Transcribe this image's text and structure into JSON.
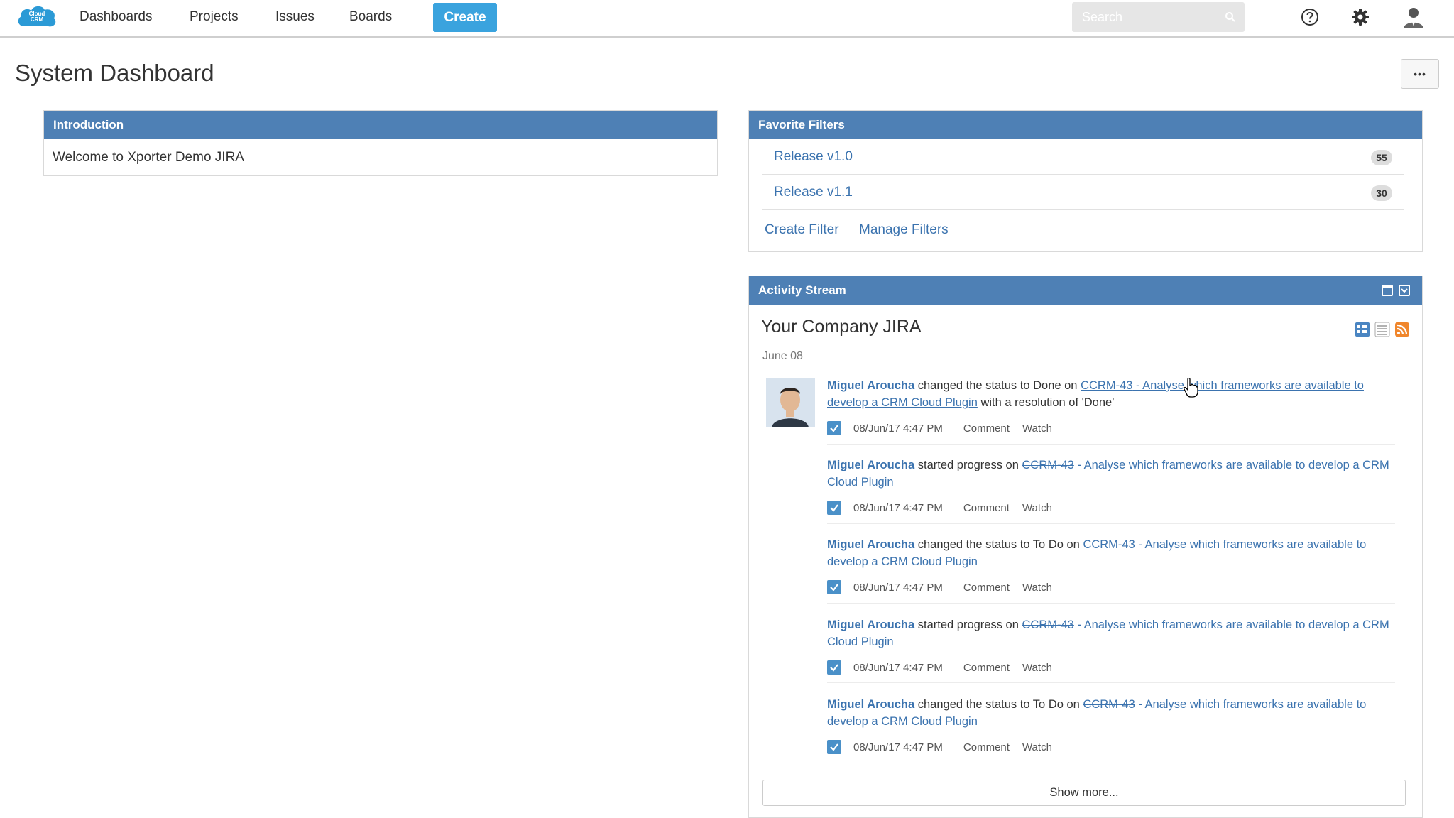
{
  "nav": {
    "logo_text": "Cloud CRM",
    "items": [
      "Dashboards",
      "Projects",
      "Issues",
      "Boards"
    ],
    "create_label": "Create",
    "search_placeholder": "Search",
    "icons": [
      "help-icon",
      "gear-icon",
      "user-avatar-icon"
    ]
  },
  "page": {
    "title": "System Dashboard",
    "more_label": "•••"
  },
  "introduction": {
    "heading": "Introduction",
    "text": "Welcome to Xporter Demo JIRA"
  },
  "favorite_filters": {
    "heading": "Favorite Filters",
    "filters": [
      {
        "name": "Release v1.0",
        "count": "55"
      },
      {
        "name": "Release v1.1",
        "count": "30"
      }
    ],
    "create_label": "Create Filter",
    "manage_label": "Manage Filters"
  },
  "activity_stream": {
    "heading": "Activity Stream",
    "title": "Your Company JIRA",
    "date": "June 08",
    "entries": [
      {
        "user": "Miguel Aroucha",
        "action": " changed the status to Done on ",
        "key": "CCRM-43",
        "summary": " - Analyse which frameworks are available to develop a CRM Cloud Plugin",
        "suffix": " with a resolution of 'Done'",
        "timestamp": "08/Jun/17 4:47 PM"
      },
      {
        "user": "Miguel Aroucha",
        "action": " started progress on ",
        "key": "CCRM-43",
        "summary": " - Analyse which frameworks are available to develop a CRM Cloud Plugin",
        "suffix": "",
        "timestamp": "08/Jun/17 4:47 PM"
      },
      {
        "user": "Miguel Aroucha",
        "action": " changed the status to To Do on ",
        "key": "CCRM-43",
        "summary": " - Analyse which frameworks are available to develop a CRM Cloud Plugin",
        "suffix": "",
        "timestamp": "08/Jun/17 4:47 PM"
      },
      {
        "user": "Miguel Aroucha",
        "action": " started progress on ",
        "key": "CCRM-43",
        "summary": " - Analyse which frameworks are available to develop a CRM Cloud Plugin",
        "suffix": "",
        "timestamp": "08/Jun/17 4:47 PM"
      },
      {
        "user": "Miguel Aroucha",
        "action": " changed the status to To Do on ",
        "key": "CCRM-43",
        "summary": " - Analyse which frameworks are available to develop a CRM Cloud Plugin",
        "suffix": "",
        "timestamp": "08/Jun/17 4:47 PM"
      }
    ],
    "comment_label": "Comment",
    "watch_label": "Watch",
    "show_more_label": "Show more..."
  },
  "colors": {
    "panel_header": "#4e80b5",
    "create_button": "#3aa3de",
    "link": "#3b73af",
    "rss": "#f0862b"
  }
}
